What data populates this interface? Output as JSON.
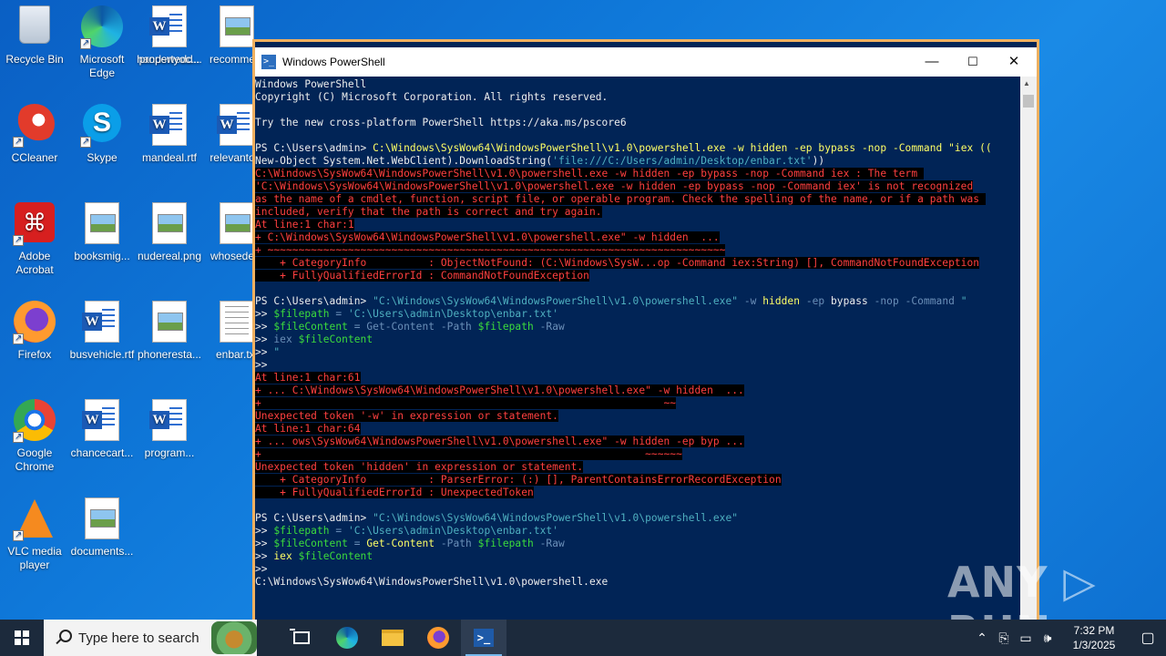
{
  "desktop_icons": [
    {
      "label": "Recycle Bin",
      "icon": "recycle-bin-icon"
    },
    {
      "label": "Microsoft Edge",
      "icon": "edge-icon"
    },
    {
      "label": "handswedd...",
      "icon": "word-doc-icon"
    },
    {
      "label": "recomme...",
      "icon": "image-file-icon"
    },
    {
      "label": "CCleaner",
      "icon": "ccleaner-icon"
    },
    {
      "label": "Skype",
      "icon": "skype-icon"
    },
    {
      "label": "mandeal.rtf",
      "icon": "word-doc-icon"
    },
    {
      "label": "relevanto...",
      "icon": "word-doc-icon"
    },
    {
      "label": "Adobe Acrobat",
      "icon": "acrobat-icon"
    },
    {
      "label": "booksmig...",
      "icon": "image-file-icon"
    },
    {
      "label": "nudereal.png",
      "icon": "image-file-icon"
    },
    {
      "label": "whosede...",
      "icon": "image-file-icon"
    },
    {
      "label": "Firefox",
      "icon": "firefox-icon"
    },
    {
      "label": "busvehicle.rtf",
      "icon": "word-doc-icon"
    },
    {
      "label": "phoneresta...",
      "icon": "image-file-icon"
    },
    {
      "label": "enbar.txt",
      "icon": "text-file-icon"
    },
    {
      "label": "Google Chrome",
      "icon": "chrome-icon"
    },
    {
      "label": "chancecart...",
      "icon": "word-doc-icon"
    },
    {
      "label": "program...",
      "icon": "word-doc-icon"
    },
    {
      "label": "VLC media player",
      "icon": "vlc-icon"
    },
    {
      "label": "documents...",
      "icon": "image-file-icon"
    },
    {
      "label": "propertyoc...",
      "icon": "word-doc-icon"
    }
  ],
  "window": {
    "title": "Windows PowerShell",
    "minimize": "—",
    "maximize": "☐",
    "close": "✕"
  },
  "console_lines": [
    [
      {
        "t": "Windows PowerShell",
        "c": "w1"
      }
    ],
    [
      {
        "t": "Copyright (C) Microsoft Corporation. All rights reserved.",
        "c": "w1"
      }
    ],
    [
      {
        "t": "",
        "c": "w1"
      }
    ],
    [
      {
        "t": "Try the new cross-platform PowerShell https://aka.ms/pscore6",
        "c": "w1"
      }
    ],
    [
      {
        "t": "",
        "c": "w1"
      }
    ],
    [
      {
        "t": "PS C:\\Users\\admin> ",
        "c": "w1"
      },
      {
        "t": "C:\\Windows\\SysWow64\\WindowsPowerShell\\v1.0\\powershell.exe",
        "c": "y"
      },
      {
        "t": " -w hidden -ep bypass -nop -Command \"iex ((",
        "c": "y"
      }
    ],
    [
      {
        "t": "New-Object System.Net.WebClient).DownloadString(",
        "c": "w1"
      },
      {
        "t": "'file:///C:/Users/admin/Desktop/enbar.txt'",
        "c": "str"
      },
      {
        "t": "))",
        "c": "w1"
      }
    ],
    [
      {
        "t": "C:\\Windows\\SysWow64\\WindowsPowerShell\\v1.0\\powershell.exe -w hidden -ep bypass -nop -Command iex : The term ",
        "c": "err"
      }
    ],
    [
      {
        "t": "'C:\\Windows\\SysWow64\\WindowsPowerShell\\v1.0\\powershell.exe -w hidden -ep bypass -nop -Command iex' is not recognized",
        "c": "err"
      }
    ],
    [
      {
        "t": "as the name of a cmdlet, function, script file, or operable program. Check the spelling of the name, or if a path was ",
        "c": "err"
      }
    ],
    [
      {
        "t": "included, verify that the path is correct and try again.",
        "c": "err"
      }
    ],
    [
      {
        "t": "At line:1 char:1",
        "c": "err"
      }
    ],
    [
      {
        "t": "+ C:\\Windows\\SysWow64\\WindowsPowerShell\\v1.0\\powershell.exe\" -w hidden  ...",
        "c": "err"
      }
    ],
    [
      {
        "t": "+ ~~~~~~~~~~~~~~~~~~~~~~~~~~~~~~~~~~~~~~~~~~~~~~~~~~~~~~~~~~~~~~~~~~~~~~~~~~",
        "c": "err"
      }
    ],
    [
      {
        "t": "    + CategoryInfo          : ObjectNotFound: (C:\\Windows\\SysW...op -Command iex:String) [], CommandNotFoundException",
        "c": "err"
      }
    ],
    [
      {
        "t": "    + FullyQualifiedErrorId : CommandNotFoundException",
        "c": "err"
      }
    ],
    [
      {
        "t": "",
        "c": "w1"
      }
    ],
    [
      {
        "t": "PS C:\\Users\\admin> ",
        "c": "w1"
      },
      {
        "t": "\"C:\\Windows\\SysWow64\\WindowsPowerShell\\v1.0\\powershell.exe\"",
        "c": "str"
      },
      {
        "t": " -w ",
        "c": "dg"
      },
      {
        "t": "hidden",
        "c": "y"
      },
      {
        "t": " -ep ",
        "c": "dg"
      },
      {
        "t": "bypass",
        "c": "w1"
      },
      {
        "t": " -nop -Command ",
        "c": "dg"
      },
      {
        "t": "\"",
        "c": "str"
      }
    ],
    [
      {
        "t": ">> ",
        "c": "w1"
      },
      {
        "t": "$filepath",
        "c": "g"
      },
      {
        "t": " = ",
        "c": "dg"
      },
      {
        "t": "'C:\\Users\\admin\\Desktop\\enbar.txt'",
        "c": "str"
      }
    ],
    [
      {
        "t": ">> ",
        "c": "w1"
      },
      {
        "t": "$fileContent",
        "c": "g"
      },
      {
        "t": " = Get-Content -Path ",
        "c": "dg"
      },
      {
        "t": "$filepath",
        "c": "g"
      },
      {
        "t": " -Raw",
        "c": "dg"
      }
    ],
    [
      {
        "t": ">> ",
        "c": "w1"
      },
      {
        "t": "iex ",
        "c": "dg"
      },
      {
        "t": "$fileContent",
        "c": "g"
      }
    ],
    [
      {
        "t": ">> ",
        "c": "w1"
      },
      {
        "t": "\"",
        "c": "str"
      }
    ],
    [
      {
        "t": ">>",
        "c": "w1"
      }
    ],
    [
      {
        "t": "At line:1 char:61",
        "c": "err"
      }
    ],
    [
      {
        "t": "+ ... C:\\Windows\\SysWow64\\WindowsPowerShell\\v1.0\\powershell.exe\" -w hidden  ...",
        "c": "err"
      }
    ],
    [
      {
        "t": "+                                                                 ~~",
        "c": "err"
      }
    ],
    [
      {
        "t": "Unexpected token '-w' in expression or statement.",
        "c": "err"
      }
    ],
    [
      {
        "t": "At line:1 char:64",
        "c": "err"
      }
    ],
    [
      {
        "t": "+ ... ows\\SysWow64\\WindowsPowerShell\\v1.0\\powershell.exe\" -w hidden -ep byp ...",
        "c": "err"
      }
    ],
    [
      {
        "t": "+                                                              ~~~~~~",
        "c": "err"
      }
    ],
    [
      {
        "t": "Unexpected token 'hidden' in expression or statement.",
        "c": "err"
      }
    ],
    [
      {
        "t": "    + CategoryInfo          : ParserError: (:) [], ParentContainsErrorRecordException",
        "c": "err"
      }
    ],
    [
      {
        "t": "    + FullyQualifiedErrorId : UnexpectedToken",
        "c": "err"
      }
    ],
    [
      {
        "t": "",
        "c": "w1"
      }
    ],
    [
      {
        "t": "PS C:\\Users\\admin> ",
        "c": "w1"
      },
      {
        "t": "\"C:\\Windows\\SysWow64\\WindowsPowerShell\\v1.0\\powershell.exe\"",
        "c": "str"
      }
    ],
    [
      {
        "t": ">> ",
        "c": "w1"
      },
      {
        "t": "$filepath",
        "c": "g"
      },
      {
        "t": " = ",
        "c": "dg"
      },
      {
        "t": "'C:\\Users\\admin\\Desktop\\enbar.txt'",
        "c": "str"
      }
    ],
    [
      {
        "t": ">> ",
        "c": "w1"
      },
      {
        "t": "$fileContent",
        "c": "g"
      },
      {
        "t": " = ",
        "c": "dg"
      },
      {
        "t": "Get-Content",
        "c": "y"
      },
      {
        "t": " -Path ",
        "c": "dg"
      },
      {
        "t": "$filepath",
        "c": "g"
      },
      {
        "t": " -Raw",
        "c": "dg"
      }
    ],
    [
      {
        "t": ">> ",
        "c": "w1"
      },
      {
        "t": "iex ",
        "c": "y"
      },
      {
        "t": "$fileContent",
        "c": "g"
      }
    ],
    [
      {
        "t": ">>",
        "c": "w1"
      }
    ],
    [
      {
        "t": "C:\\Windows\\SysWow64\\WindowsPowerShell\\v1.0\\powershell.exe",
        "c": "w1"
      }
    ]
  ],
  "watermark": "ANY ▷ RUN",
  "taskbar": {
    "search_placeholder": "Type here to search",
    "clock_time": "7:32 PM",
    "clock_date": "1/3/2025",
    "tray_icons": [
      "chevron-up-icon",
      "network-icon",
      "display-icon",
      "volume-icon"
    ]
  },
  "colors": {
    "console_bg": "#012456",
    "error_fg": "#ff4040",
    "highlight_yellow": "#ffff66",
    "variable_green": "#3cdc3c",
    "taskbar_bg": "#1c2a3c"
  }
}
